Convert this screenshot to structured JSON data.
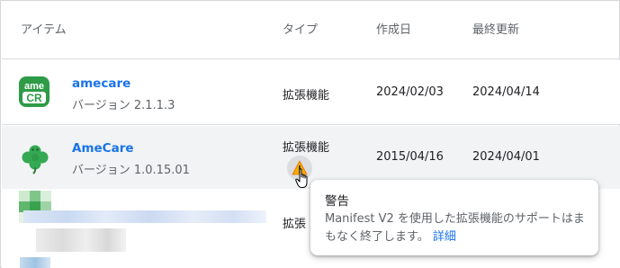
{
  "columns": {
    "item": "アイテム",
    "type": "タイプ",
    "created": "作成日",
    "updated": "最終更新"
  },
  "rows": [
    {
      "icon": "amecare-cr-logo",
      "logo_text_top": "ame",
      "logo_text_bottom": "CR",
      "name": "amecare",
      "version": "バージョン 2.1.1.3",
      "type": "拡張機能",
      "created": "2024/02/03",
      "updated": "2024/04/14"
    },
    {
      "icon": "clover-icon",
      "name": "AmeCare",
      "version": "バージョン 1.0.15.01",
      "type": "拡張機能",
      "created": "2015/04/16",
      "updated": "2024/04/01",
      "has_warning": true
    },
    {
      "icon": "blurred-icon",
      "name": "",
      "version": "",
      "type": "拡張",
      "created": "",
      "updated": ""
    }
  ],
  "tooltip": {
    "title": "警告",
    "body": "Manifest V2 を使用した拡張機能のサポートはまもなく終了します。",
    "link": "詳細"
  },
  "colors": {
    "link": "#1a73e8",
    "logo_green": "#2e9b47",
    "warning": "#f9ab00"
  }
}
